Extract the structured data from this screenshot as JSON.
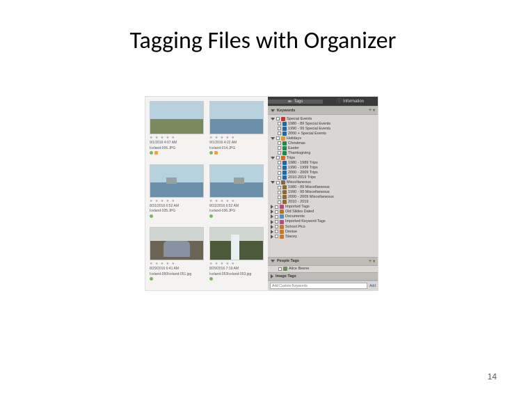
{
  "title": "Tagging Files with Organizer",
  "page_number": "14",
  "tabs": {
    "tags": "Tags",
    "info": "Information"
  },
  "sections": {
    "keywords": "Keywords",
    "people": "People Tags",
    "image": "Image Tags"
  },
  "thumbs": [
    {
      "date": "9/1/2016 4:07 AM",
      "file": "Iceland-006.JPG"
    },
    {
      "date": "9/1/2016 4:22 AM",
      "file": "Iceland-014.JPG"
    },
    {
      "date": "8/31/2016 6:52 AM",
      "file": "Iceland-035.JPG"
    },
    {
      "date": "8/31/2016 6:52 AM",
      "file": "Iceland-036.JPG"
    },
    {
      "date": "8/29/2016 6:41 AM",
      "file": "Iceland-050Iceland-051.jpg"
    },
    {
      "date": "8/29/2016 7:19 AM",
      "file": "Iceland-053Iceland-053.jpg"
    }
  ],
  "rating": "★ ★ ★ ★ ★",
  "tree": [
    {
      "lv": 1,
      "label": "Special Events",
      "color": "#c0392b",
      "expanded": true
    },
    {
      "lv": 2,
      "label": "1980 - 89 Special Events",
      "color": "#1f6aa5"
    },
    {
      "lv": 2,
      "label": "1990 - 99 Special Events",
      "color": "#1f6aa5"
    },
    {
      "lv": 2,
      "label": "2000 + Special Events",
      "color": "#1f6aa5"
    },
    {
      "lv": 1,
      "label": "Holidays",
      "color": "#e29a2e",
      "expanded": true
    },
    {
      "lv": 2,
      "label": "Christmas",
      "color": "#1f8a4c"
    },
    {
      "lv": 2,
      "label": "Easter",
      "color": "#1f8a4c"
    },
    {
      "lv": 2,
      "label": "Thanksgiving",
      "color": "#1f8a4c"
    },
    {
      "lv": 1,
      "label": "Trips",
      "color": "#d46a2e",
      "expanded": true
    },
    {
      "lv": 2,
      "label": "1980 - 1989 Trips",
      "color": "#1f6aa5"
    },
    {
      "lv": 2,
      "label": "1990 - 1999 Trips",
      "color": "#1f6aa5"
    },
    {
      "lv": 2,
      "label": "2000 - 2009 Trips",
      "color": "#1f6aa5"
    },
    {
      "lv": 2,
      "label": "2010-2019 Trips",
      "color": "#1f6aa5"
    },
    {
      "lv": 1,
      "label": "Miscellaneous",
      "color": "#7a6a50",
      "expanded": true
    },
    {
      "lv": 2,
      "label": "1980 - 89 Miscellaneous",
      "color": "#8a6a3a"
    },
    {
      "lv": 2,
      "label": "1990 - 99 Miscellaneous",
      "color": "#8a6a3a"
    },
    {
      "lv": 2,
      "label": "2000 - 2009 Miscellaneous",
      "color": "#8a6a3a"
    },
    {
      "lv": 2,
      "label": "2010 - 2019",
      "color": "#8a6a3a"
    },
    {
      "lv": 1,
      "label": "Imported Tags",
      "color": "#b94c7a"
    },
    {
      "lv": 1,
      "label": "Old Slides Dated",
      "color": "#b9742c"
    },
    {
      "lv": 1,
      "label": "Documents",
      "color": "#4a90c2"
    },
    {
      "lv": 1,
      "label": "Imported Keyword Tags",
      "color": "#b94c7a"
    },
    {
      "lv": 1,
      "label": "School Pics",
      "color": "#c27a2c"
    },
    {
      "lv": 1,
      "label": "Denise",
      "color": "#c27a2c"
    },
    {
      "lv": 1,
      "label": "Stacey",
      "color": "#c27a2c"
    }
  ],
  "people": [
    {
      "lv": 2,
      "label": "Alice Beene",
      "color": "#6a8a5a"
    }
  ],
  "input": {
    "placeholder": "Add Custom Keywords",
    "add": "Add"
  }
}
